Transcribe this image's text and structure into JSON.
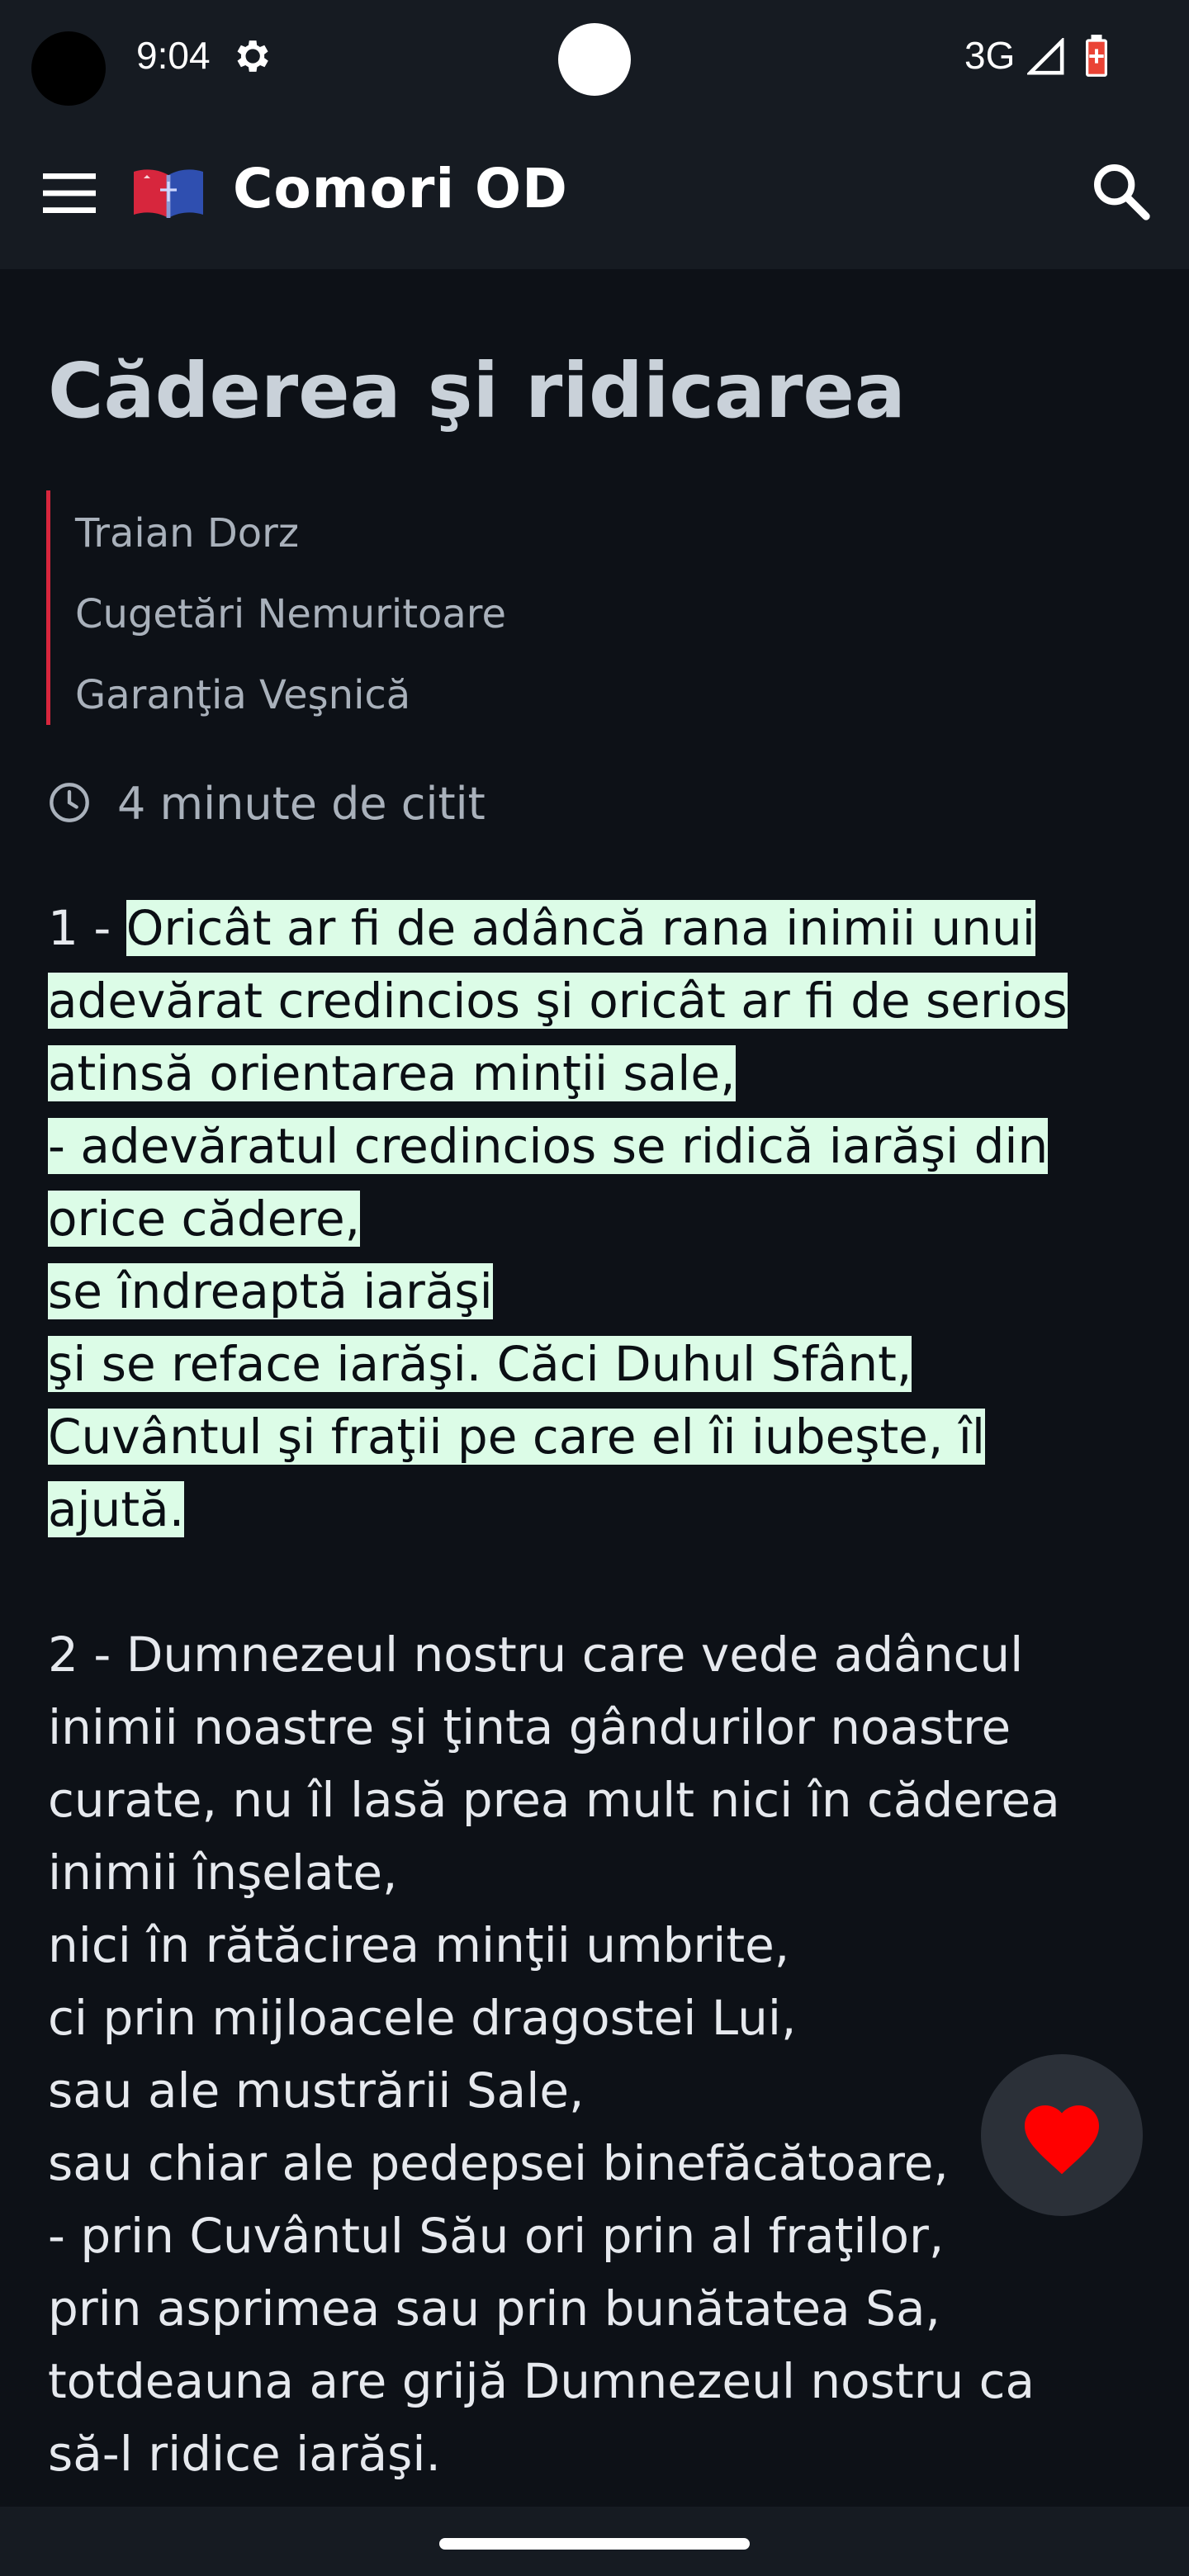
{
  "status_bar": {
    "time": "9:04",
    "network": "3G",
    "icons": [
      "gear-icon",
      "signal-icon",
      "battery-icon"
    ]
  },
  "app_bar": {
    "title": "Comori OD",
    "icons": [
      "menu-icon",
      "book-logo-icon",
      "search-icon"
    ]
  },
  "article": {
    "title": "Căderea şi ridicarea",
    "author": "Traian Dorz",
    "book": "Cugetări Nemuritoare",
    "chapter": "Garanţia Veşnică",
    "reading_time": "4 minute de citit",
    "verse1": {
      "prefix": "1 - ",
      "lines": [
        "Oricât ar fi de adâncă rana inimii unui",
        "adevărat credincios şi oricât ar fi de serios",
        "atinsă orientarea minţii sale,",
        "- adevăratul credincios se ridică iarăşi din",
        "orice cădere,",
        "se îndreaptă iarăşi",
        "şi se reface iarăşi. Căci Duhul Sfânt,",
        "Cuvântul şi fraţii pe care el îi iubeşte, îl",
        "ajută."
      ]
    },
    "verse2": {
      "lines": [
        "2 - Dumnezeul nostru care vede adâncul",
        "inimii noastre şi ţinta gândurilor noastre",
        "curate, nu îl lasă prea mult nici în căderea",
        "inimii înşelate,",
        "nici în rătăcirea minţii umbrite,",
        "ci prin mijloacele dragostei Lui,",
        "sau ale mustrării Sale,",
        "sau chiar ale pedepsei binefăcătoare,",
        "- prin Cuvântul Său ori prin al fraţilor,",
        "prin asprimea sau prin bunătatea Sa,",
        "totdeauna are grijă Dumnezeul nostru ca",
        "să-l ridice iarăşi."
      ]
    }
  },
  "fab": {
    "icon": "heart-icon"
  },
  "colors": {
    "background": "#0d1117",
    "bar": "#161b22",
    "highlight": "#dcfce7",
    "accent_red": "#d7263d",
    "heart": "#ff0000"
  }
}
